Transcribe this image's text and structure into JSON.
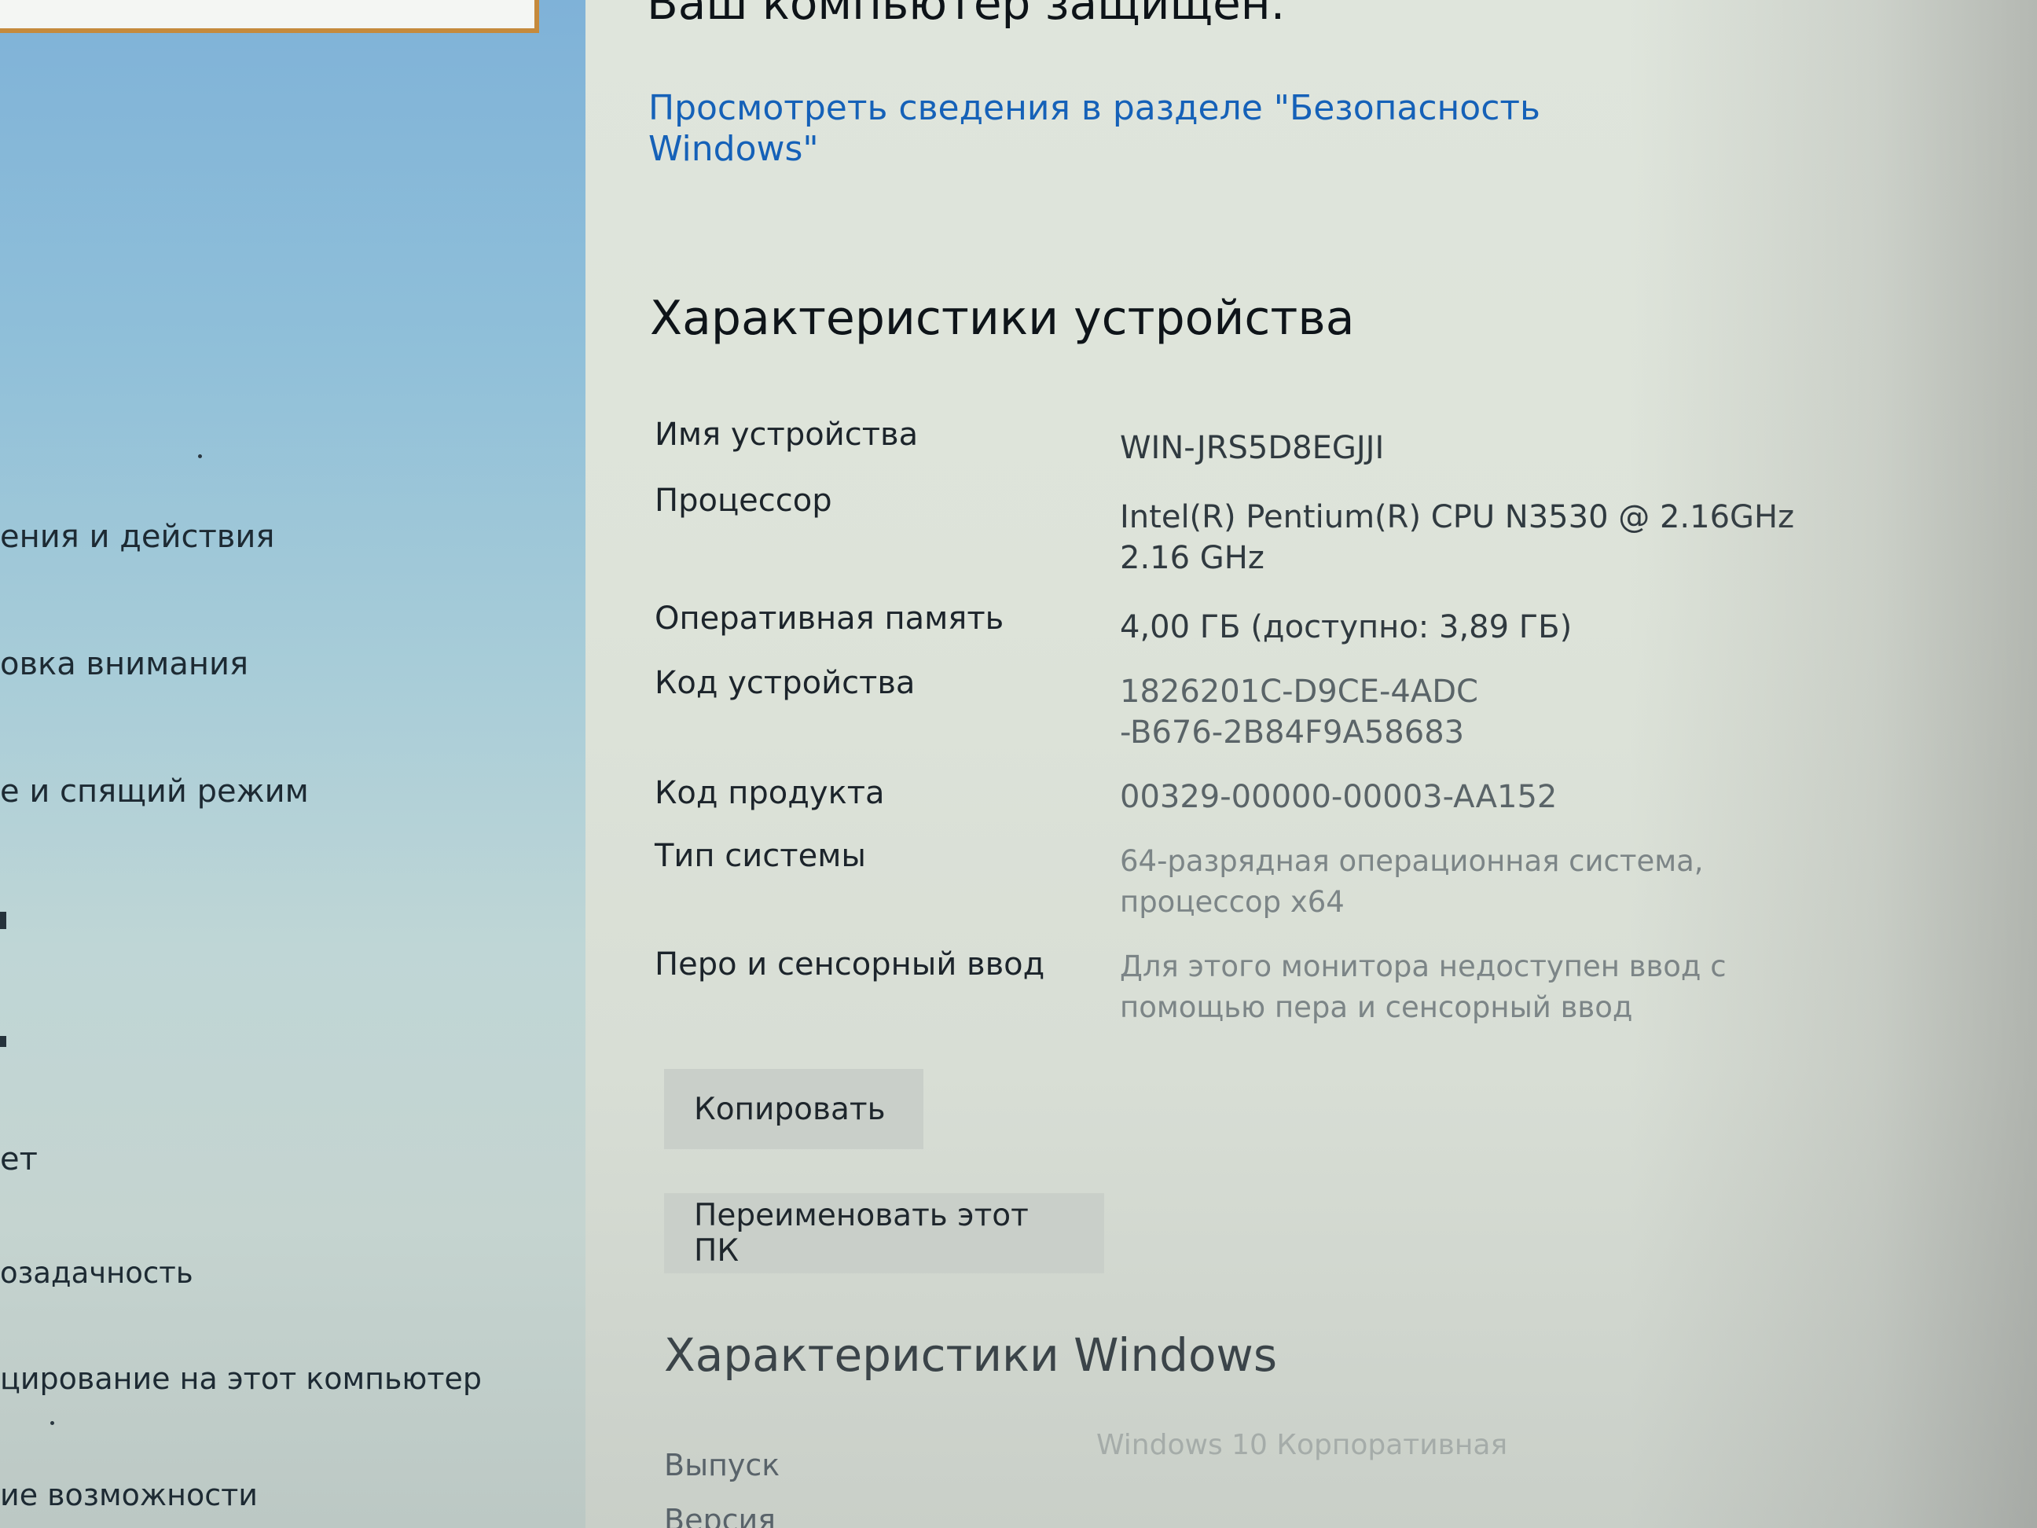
{
  "sidebar": {
    "items": [
      {
        "label": "ения и действия"
      },
      {
        "label": "овка внимания"
      },
      {
        "label": "е и спящий режим"
      },
      {
        "label": "ет"
      },
      {
        "label": "озадачность"
      },
      {
        "label": "цирование на этот компьютер"
      },
      {
        "label": "ие возможности"
      }
    ]
  },
  "main": {
    "protection_status": "Ваш компьютер защищен.",
    "security_link": "Просмотреть сведения в разделе \"Безопасность Windows\"",
    "device_specs": {
      "title": "Характеристики устройства",
      "rows": [
        {
          "label": "Имя устройства",
          "value": "WIN-JRS5D8EGJJI"
        },
        {
          "label": "Процессор",
          "value": "Intel(R) Pentium(R) CPU  N3530  @ 2.16GHz 2.16 GHz"
        },
        {
          "label": "Оперативная память",
          "value": "4,00 ГБ (доступно: 3,89 ГБ)"
        },
        {
          "label": "Код устройства",
          "value": "1826201C-D9CE-4ADC-B676-2B84F9A58683"
        },
        {
          "label": "Код продукта",
          "value": "00329-00000-00003-AA152"
        },
        {
          "label": "Тип системы",
          "value": "64-разрядная операционная система, процессор x64"
        },
        {
          "label": "Перо и сенсорный ввод",
          "value": "Для этого монитора недоступен ввод с помощью пера и сенсорный ввод"
        }
      ],
      "copy_button": "Копировать",
      "rename_button": "Переименовать этот ПК"
    },
    "windows_specs": {
      "title": "Характеристики Windows",
      "rows": [
        {
          "label": "Выпуск",
          "value": "Windows 10 Корпоративная"
        },
        {
          "label": "Версия",
          "value": ""
        }
      ]
    }
  }
}
